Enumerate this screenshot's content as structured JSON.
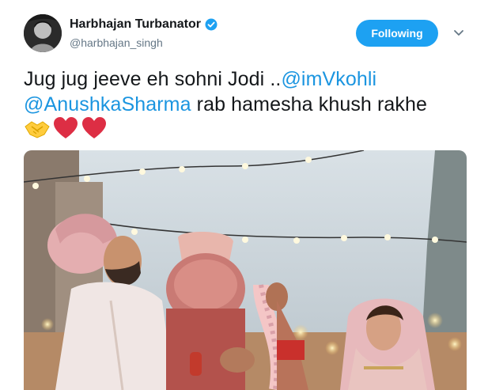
{
  "user": {
    "display_name": "Harbhajan Turbanator",
    "handle": "@harbhajan_singh",
    "verified": true
  },
  "actions": {
    "follow_label": "Following",
    "menu_icon": "chevron-down-icon"
  },
  "tweet": {
    "text_part1": "Jug jug jeeve eh sohni Jodi ..",
    "mention1": "@imVkohli",
    "mention2": "@AnushkaSharma",
    "text_part2": " rab hamesha khush rakhe",
    "emojis": [
      "handshake-emoji",
      "red-heart-emoji",
      "red-heart-emoji"
    ]
  },
  "media": {
    "kind": "wedding-photo"
  },
  "colors": {
    "accent": "#1da1f2",
    "mention": "#1b95e0",
    "handle": "#657786",
    "text": "#14171a"
  }
}
